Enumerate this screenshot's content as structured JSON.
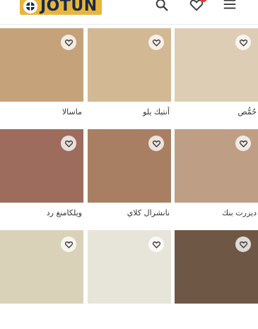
{
  "brand": {
    "name": "JOTUN",
    "logo_color": "#e8b63c",
    "text_color": "#1b2a49"
  },
  "header": {
    "icons": [
      "search-icon",
      "heart-icon",
      "menu-icon"
    ],
    "favorites_badge_color": "#e53935"
  },
  "colors": [
    {
      "name": "ماسالا",
      "hex": "#c5a27a"
    },
    {
      "name": "أنتيك يلو",
      "hex": "#d2b893"
    },
    {
      "name": "حُمُّص",
      "hex": "#dccdb4"
    },
    {
      "name": "ويلكامنغ رد",
      "hex": "#9d6c5d"
    },
    {
      "name": "نانشرال كلاي",
      "hex": "#a97f63"
    },
    {
      "name": "ديزرت بنك",
      "hex": "#be9e85"
    },
    {
      "name": "",
      "hex": "#d9d2b8"
    },
    {
      "name": "",
      "hex": "#e7e5da"
    },
    {
      "name": "",
      "hex": "#6f5746"
    }
  ]
}
